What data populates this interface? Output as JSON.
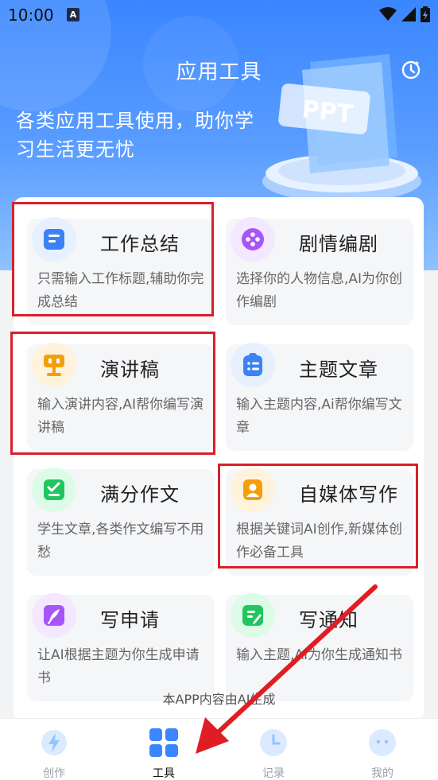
{
  "status_bar": {
    "time": "10:00",
    "notification_badge": "A"
  },
  "header": {
    "title": "应用工具",
    "tagline": "各类应用工具使用，助你学习生活更无忧",
    "illustration_text": "PPT"
  },
  "tools": [
    {
      "title": "工作总结",
      "desc": "只需输入工作标题,辅助你完成总结",
      "icon": "document-icon",
      "color": "#3b82f6",
      "highlighted": true
    },
    {
      "title": "剧情编剧",
      "desc": "选择你的人物信息,AI为你创作编剧",
      "icon": "film-reel-icon",
      "color": "#a855f7",
      "highlighted": false
    },
    {
      "title": "演讲稿",
      "desc": "输入演讲内容,AI帮你编写演讲稿",
      "icon": "podium-icon",
      "color": "#f59e0b",
      "highlighted": true
    },
    {
      "title": "主题文章",
      "desc": "输入主题内容,Ai帮你编写文章",
      "icon": "clipboard-list-icon",
      "color": "#3b82f6",
      "highlighted": false
    },
    {
      "title": "满分作文",
      "desc": "学生文章,各类作文编写不用愁",
      "icon": "checklist-icon",
      "color": "#22c55e",
      "highlighted": false
    },
    {
      "title": "自媒体写作",
      "desc": "根据关键词AI创作,新媒体创作必备工具",
      "icon": "profile-card-icon",
      "color": "#f59e0b",
      "highlighted": true
    },
    {
      "title": "写申请",
      "desc": "让AI根据主题为你生成申请书",
      "icon": "quill-pen-icon",
      "color": "#a855f7",
      "highlighted": false
    },
    {
      "title": "写通知",
      "desc": "输入主题,AI为你生成通知书",
      "icon": "edit-note-icon",
      "color": "#22c55e",
      "highlighted": false
    }
  ],
  "notice": "本APP内容由AI生成",
  "tabbar": [
    {
      "label": "创作",
      "icon": "lightning-icon",
      "active": false
    },
    {
      "label": "工具",
      "icon": "grid-icon",
      "active": true
    },
    {
      "label": "记录",
      "icon": "clock-icon",
      "active": false
    },
    {
      "label": "我的",
      "icon": "smile-chat-icon",
      "active": false
    }
  ],
  "colors": {
    "header_blue": "#3a86ff",
    "highlight_red": "#d9202b",
    "tab_active_blue": "#3a86ff"
  }
}
